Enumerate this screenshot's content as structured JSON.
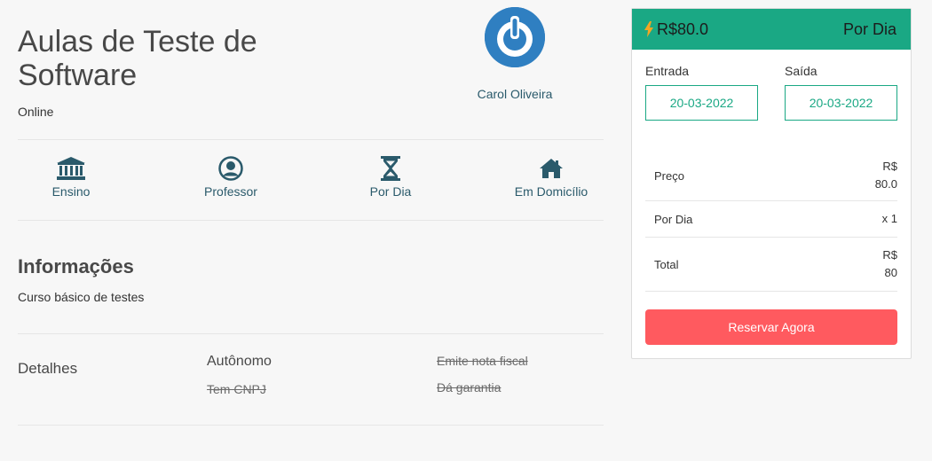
{
  "listing": {
    "title": "Aulas de Teste de Software",
    "mode": "Online"
  },
  "owner": {
    "name": "Carol Oliveira",
    "avatar_icon": "power-icon",
    "avatar_color": "#2f7fc1"
  },
  "features": [
    {
      "label": "Ensino",
      "icon": "bank-icon"
    },
    {
      "label": "Professor",
      "icon": "user-circle-icon"
    },
    {
      "label": "Por Dia",
      "icon": "hourglass-icon"
    },
    {
      "label": "Em Domicílio",
      "icon": "home-icon"
    }
  ],
  "info": {
    "title": "Informações",
    "description": "Curso básico de testes"
  },
  "details": {
    "title": "Detalhes",
    "items": [
      {
        "label": "Autônomo",
        "available": true
      },
      {
        "label": "Tem CNPJ",
        "available": false
      },
      {
        "label": "Emite nota fiscal",
        "available": false
      },
      {
        "label": "Dá garantia",
        "available": false
      }
    ]
  },
  "booking": {
    "price": "R$80.0",
    "period": "Por Dia",
    "checkin_label": "Entrada",
    "checkin_value": "20-03-2022",
    "checkout_label": "Saída",
    "checkout_value": "20-03-2022",
    "summary": [
      {
        "label": "Preço",
        "line1": "R$",
        "line2": "80.0"
      },
      {
        "label": "Por Dia",
        "line1": "x 1",
        "line2": ""
      },
      {
        "label": "Total",
        "line1": "R$",
        "line2": "80"
      }
    ],
    "reserve_label": "Reservar Agora"
  },
  "colors": {
    "accent": "#1aa884",
    "brand_text": "#2a5a6b",
    "cta": "#ff5a5f",
    "lightning": "#f5a623"
  }
}
